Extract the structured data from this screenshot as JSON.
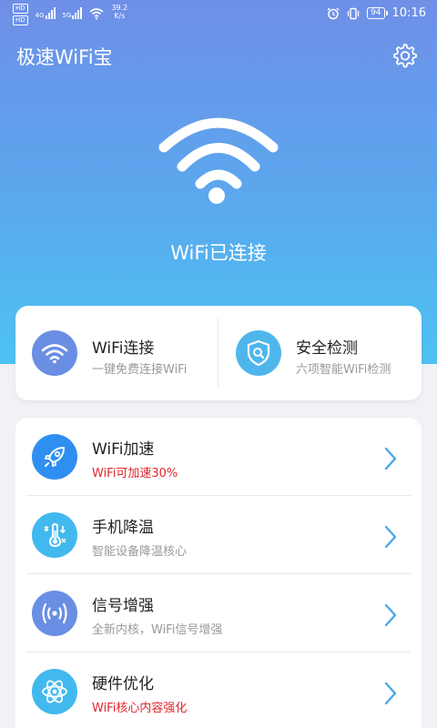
{
  "status_bar": {
    "sim1": "HD",
    "sim2": "HD",
    "net1": "4G",
    "net2": "5G",
    "speed_value": "39.2",
    "speed_unit": "K/s",
    "battery": "94",
    "time": "10:16"
  },
  "header": {
    "app_title": "极速WiFi宝",
    "settings_icon": "gear-icon"
  },
  "hero": {
    "wifi_icon": "wifi-icon",
    "status_text": "WiFi已连接"
  },
  "quick_actions": [
    {
      "title": "WiFi连接",
      "subtitle": "一键免费连接WiFi",
      "icon": "wifi-icon",
      "color": "#6a8ee3"
    },
    {
      "title": "安全检测",
      "subtitle": "六项智能WiFi检测",
      "icon": "shield-icon",
      "color": "#4fb6ec"
    }
  ],
  "list": [
    {
      "title": "WiFi加速",
      "subtitle": "WiFi可加速30%",
      "subtitle_color": "#e0262c",
      "icon": "rocket-icon",
      "color": "#2f8ff0"
    },
    {
      "title": "手机降温",
      "subtitle": "智能设备降温核心",
      "subtitle_color": "#999999",
      "icon": "thermometer-icon",
      "color": "#42b9ee"
    },
    {
      "title": "信号增强",
      "subtitle": "全新内核，WiFi信号增强",
      "subtitle_color": "#999999",
      "icon": "signal-icon",
      "color": "#6a8ee3"
    },
    {
      "title": "硬件优化",
      "subtitle": "WiFi核心内容强化",
      "subtitle_color": "#e0262c",
      "icon": "atom-icon",
      "color": "#42b9ee"
    }
  ],
  "colors": {
    "hero_top": "#6f8fe7",
    "hero_bottom": "#4ec2f2",
    "accent_chevron": "#4aa8e6"
  }
}
